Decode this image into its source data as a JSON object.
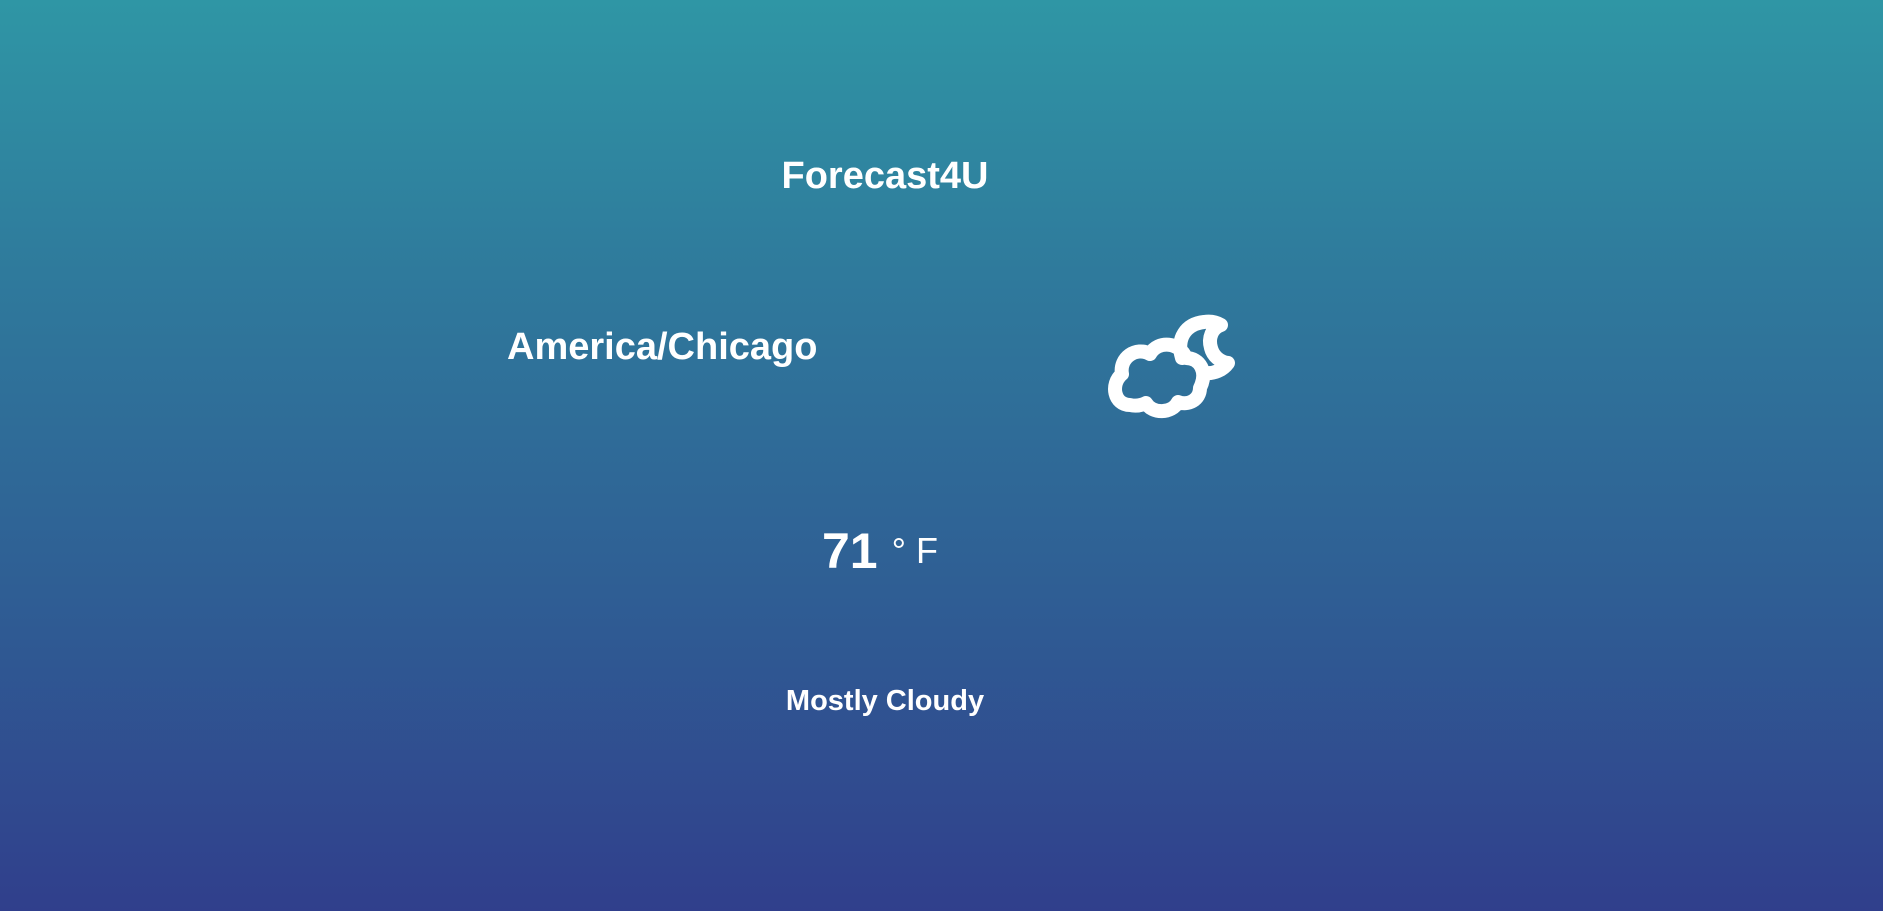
{
  "app": {
    "title": "Forecast4U"
  },
  "location": {
    "timezone": "America/Chicago"
  },
  "weather": {
    "icon": "partly-cloudy-night-icon",
    "temperature": "71",
    "unit": "° F",
    "condition": "Mostly Cloudy"
  },
  "colors": {
    "gradient_top": "#2f96a5",
    "gradient_bottom": "#303f8c",
    "text": "#ffffff"
  }
}
